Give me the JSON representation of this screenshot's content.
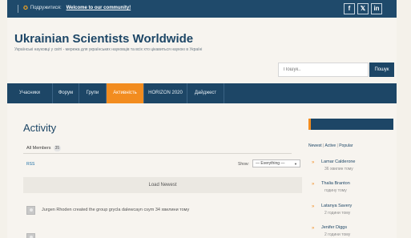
{
  "topbar": {
    "join_label": "Подружитися:",
    "join_link": "Welcome to our community!",
    "social": [
      "f",
      "𝕏",
      "in"
    ]
  },
  "header": {
    "title": "Ukrainian Scientists Worldwide",
    "tagline": "Українські науковці у світі - мережа для українських науковців та всіх хто цікавиться наукою в Україні"
  },
  "search": {
    "placeholder": "Пошук..",
    "button_label": "Пошук"
  },
  "nav": {
    "items": [
      {
        "label": "Учасники"
      },
      {
        "label": "Форум"
      },
      {
        "label": "Групи"
      },
      {
        "label": "Активність",
        "active": true
      },
      {
        "label": "HORIZON 2020"
      },
      {
        "label": "Дайджест"
      }
    ]
  },
  "main": {
    "title": "Activity",
    "tab_label": "All Members",
    "tab_count": "35",
    "rss_label": "RSS",
    "show_label": "Show:",
    "show_selected": "— Everything —",
    "load_newest": "Load Newest",
    "activities": [
      {
        "text": "Jurgen Rhoden created the group grycla dalewcayn csym 34 хвилини тому"
      },
      {
        "text": ""
      }
    ]
  },
  "sidebar": {
    "tabs": [
      "Newest",
      "Active",
      "Popular"
    ],
    "members": [
      {
        "name": "Lamar Calderone",
        "time": "36 хвилин тому"
      },
      {
        "name": "Thalia Branton",
        "time": "годину тому"
      },
      {
        "name": "Latanya Savery",
        "time": "2 години тому"
      },
      {
        "name": "Jenifer Diggs",
        "time": "2 години тому"
      }
    ]
  },
  "colors": {
    "brand_blue": "#1d4666",
    "accent_orange": "#f28c1f"
  }
}
